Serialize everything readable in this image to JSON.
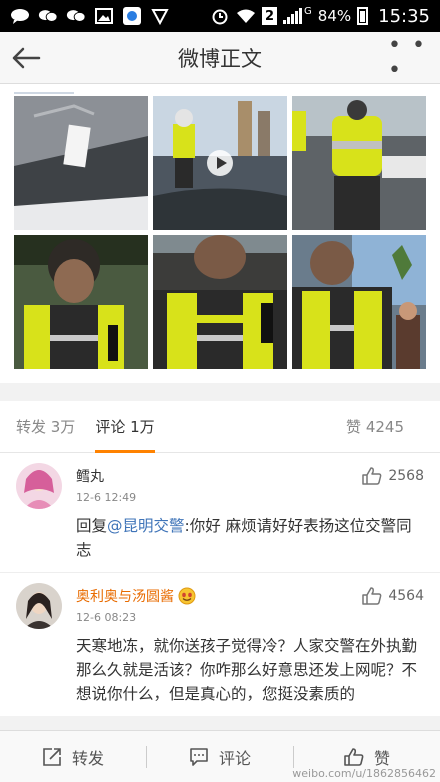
{
  "status_bar": {
    "battery_text": "84%",
    "time": "15:35",
    "badge_number": "2",
    "network": "G"
  },
  "header": {
    "title": "微博正文",
    "more": "• • •"
  },
  "tabs": {
    "repost": "转发 3万",
    "comment": "评论 1万",
    "like": "赞 4245"
  },
  "comments": [
    {
      "name": "鳕丸",
      "time": "12-6 12:49",
      "likes": "2568",
      "reply_prefix": "回复",
      "mention": "@昆明交警",
      "text": ":你好 麻烦请好好表扬这位交警同志"
    },
    {
      "name": "奥利奥与汤圆酱",
      "time": "12-6 08:23",
      "likes": "4564",
      "text": "天寒地冻，就你送孩子觉得冷？人家交警在外执勤那么久就是活该？你咋那么好意思还发上网呢？不想说你什么，但是真心的，您挺没素质的"
    }
  ],
  "bottom_bar": {
    "repost": "转发",
    "comment": "评论",
    "like": "赞"
  },
  "watermark": "weibo.com/u/1862856462",
  "colors": {
    "accent": "#ff8200",
    "mention": "#3f74b8",
    "vip_name": "#e86b00",
    "vest_yellow": "#d8e21a"
  }
}
